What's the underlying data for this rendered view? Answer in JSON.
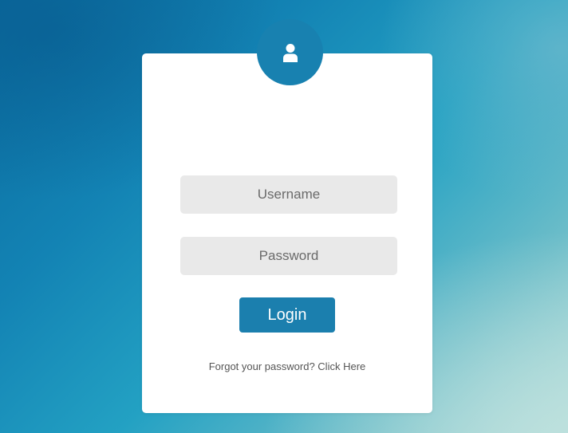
{
  "login_form": {
    "avatar_icon": "user-icon",
    "username_placeholder": "Username",
    "username_value": "",
    "password_placeholder": "Password",
    "password_value": "",
    "login_label": "Login",
    "forgot_prompt": "Forgot your password?",
    "forgot_link": "Click Here"
  },
  "colors": {
    "accent": "#1881b0",
    "field_background": "#e9e9e9",
    "card_background": "#ffffff"
  }
}
